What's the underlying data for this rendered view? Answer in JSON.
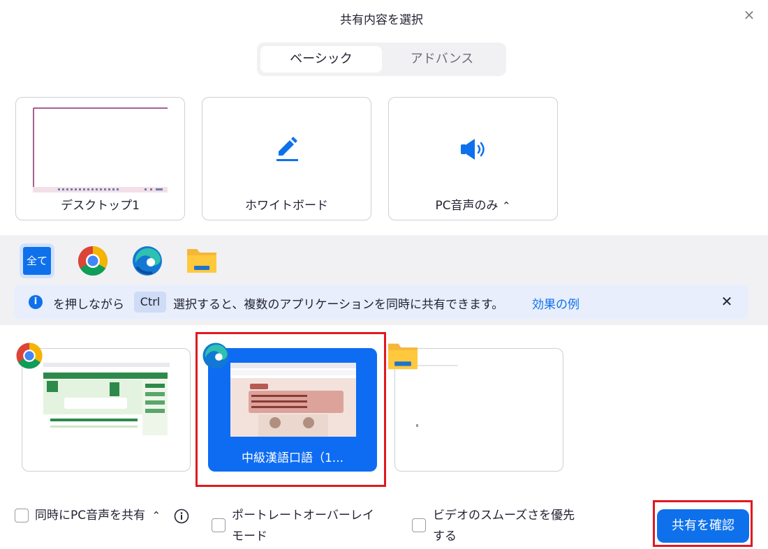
{
  "dialog": {
    "title": "共有内容を選択",
    "close_icon": "×"
  },
  "tabs": [
    {
      "label": "ベーシック",
      "active": true
    },
    {
      "label": "アドバンス",
      "active": false
    }
  ],
  "share_cards": [
    {
      "label": "デスクトップ1",
      "icon": "desktop-thumbnail"
    },
    {
      "label": "ホワイトボード",
      "icon": "pencil-icon"
    },
    {
      "label": "PC音声のみ",
      "icon": "speaker-icon",
      "chevron": "⌃"
    }
  ],
  "app_filters": [
    {
      "label": "全て",
      "selected": true
    },
    {
      "icon": "chrome-icon"
    },
    {
      "icon": "edge-icon"
    },
    {
      "icon": "folder-icon"
    }
  ],
  "info_bar": {
    "text_before": "を押しながら",
    "key": "Ctrl",
    "text_after": "選択すると、複数のアプリケーションを同時に共有できます。",
    "link": "効果の例"
  },
  "windows": [
    {
      "app": "chrome",
      "label": "",
      "selected": false
    },
    {
      "app": "edge",
      "label": "中級漢語口語（1...",
      "selected": true
    },
    {
      "app": "explorer",
      "label": "",
      "selected": false
    }
  ],
  "options": {
    "share_audio": "同時にPC音声を共有",
    "portrait_overlay_line1": "ポートレートオーバーレイ",
    "portrait_overlay_line2": "モード",
    "video_smooth_line1": "ビデオのスムーズさを優先",
    "video_smooth_line2": "する"
  },
  "confirm_button": "共有を確認",
  "colors": {
    "accent": "#0e71eb",
    "highlight": "#e0191f",
    "band": "#f1f1f4"
  }
}
